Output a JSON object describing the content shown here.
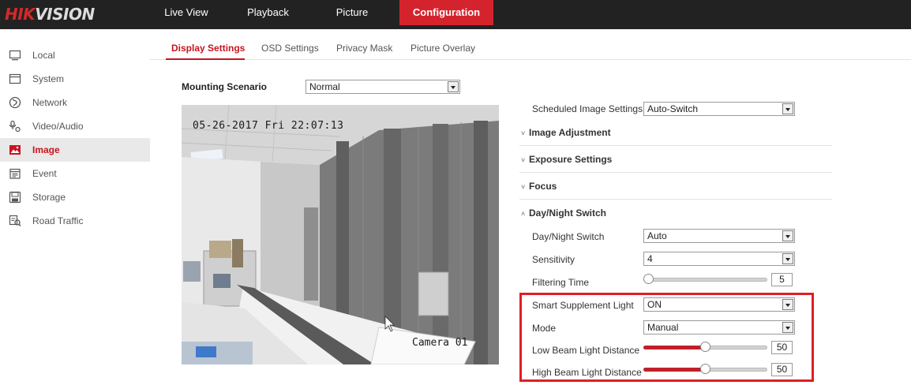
{
  "brand": {
    "hik": "HIK",
    "vision": "VISION"
  },
  "topnav": [
    {
      "label": "Live View",
      "active": false
    },
    {
      "label": "Playback",
      "active": false
    },
    {
      "label": "Picture",
      "active": false
    },
    {
      "label": "Configuration",
      "active": true
    }
  ],
  "sidebar": [
    {
      "label": "Local",
      "icon": "monitor-icon",
      "active": false
    },
    {
      "label": "System",
      "icon": "window-icon",
      "active": false
    },
    {
      "label": "Network",
      "icon": "globe-icon",
      "active": false
    },
    {
      "label": "Video/Audio",
      "icon": "mic-icon",
      "active": false
    },
    {
      "label": "Image",
      "icon": "image-icon",
      "active": true
    },
    {
      "label": "Event",
      "icon": "calendar-icon",
      "active": false
    },
    {
      "label": "Storage",
      "icon": "disk-icon",
      "active": false
    },
    {
      "label": "Road Traffic",
      "icon": "traffic-icon",
      "active": false
    }
  ],
  "subtabs": [
    {
      "label": "Display Settings",
      "active": true
    },
    {
      "label": "OSD Settings",
      "active": false
    },
    {
      "label": "Privacy Mask",
      "active": false
    },
    {
      "label": "Picture Overlay",
      "active": false
    }
  ],
  "mounting": {
    "label": "Mounting Scenario",
    "value": "Normal"
  },
  "camera": {
    "timestamp": "05-26-2017 Fri 22:07:13",
    "name": "Camera 01"
  },
  "scheduled": {
    "label": "Scheduled Image Settings",
    "value": "Auto-Switch"
  },
  "sections": [
    {
      "title": "Image Adjustment",
      "chevron": "˅"
    },
    {
      "title": "Exposure Settings",
      "chevron": "˅"
    },
    {
      "title": "Focus",
      "chevron": "˅"
    },
    {
      "title": "Day/Night Switch",
      "chevron": "˄"
    }
  ],
  "daynight": {
    "switch": {
      "label": "Day/Night Switch",
      "value": "Auto"
    },
    "sensitivity": {
      "label": "Sensitivity",
      "value": "4"
    },
    "filtering": {
      "label": "Filtering Time",
      "value": "5",
      "fraction": 0
    },
    "smart": {
      "label": "Smart Supplement Light",
      "value": "ON"
    },
    "mode": {
      "label": "Mode",
      "value": "Manual"
    },
    "low_beam": {
      "label": "Low Beam Light Distance",
      "value": "50",
      "fraction": 0.5
    },
    "high_beam": {
      "label": "High Beam Light Distance",
      "value": "50",
      "fraction": 0.5
    }
  },
  "colors": {
    "accent": "#d5232d",
    "topbar": "#222222",
    "highlight": "#e11d25"
  }
}
